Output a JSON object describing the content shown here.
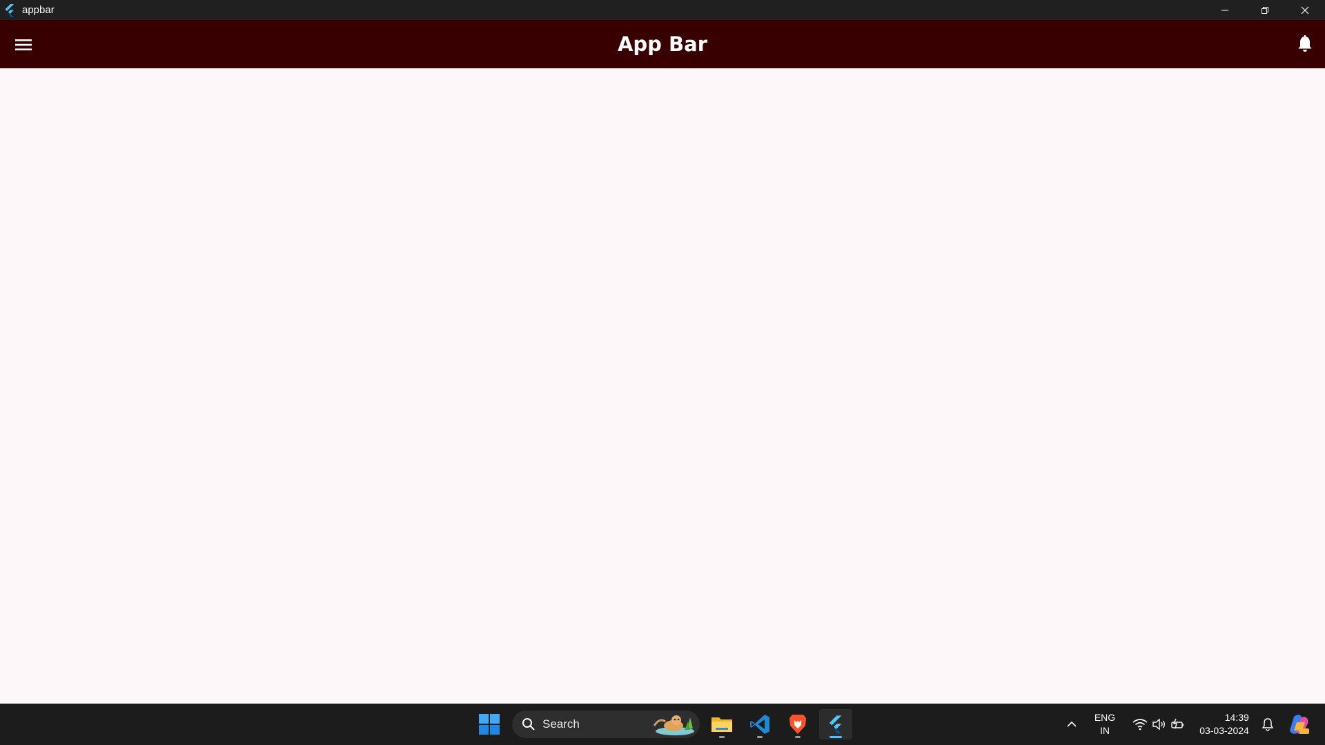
{
  "window": {
    "title": "appbar"
  },
  "appbar": {
    "title": "App Bar",
    "background": "#390001"
  },
  "content": {
    "background": "#fef7fa"
  },
  "taskbar": {
    "search_placeholder": "Search",
    "pinned_apps": [
      "windows-start",
      "file-explorer",
      "visual-studio-code",
      "brave-browser",
      "flutter-app"
    ],
    "language_primary": "ENG",
    "language_secondary": "IN",
    "time": "14:39",
    "date": "03-03-2024"
  }
}
